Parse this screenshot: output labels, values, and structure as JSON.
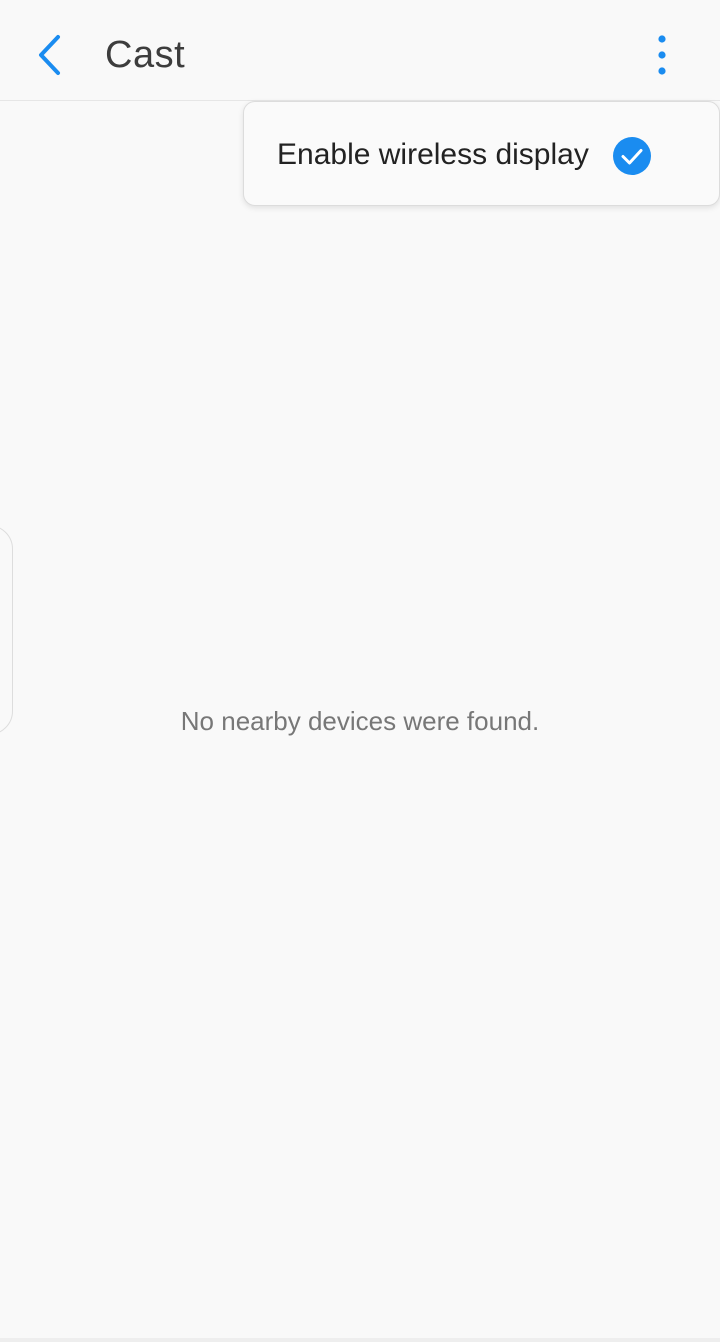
{
  "header": {
    "title": "Cast",
    "back_icon": "chevron-left-icon",
    "more_icon": "more-vertical-icon"
  },
  "menu": {
    "items": [
      {
        "label": "Enable wireless display",
        "checked": true,
        "check_icon": "check-circle-icon"
      }
    ]
  },
  "main": {
    "empty_message": "No nearby devices were found."
  },
  "colors": {
    "accent": "#1a8cf0",
    "title_text": "#3d3d3d",
    "menu_text": "#222222",
    "secondary_text": "#777777",
    "background": "#f9f9f9"
  }
}
